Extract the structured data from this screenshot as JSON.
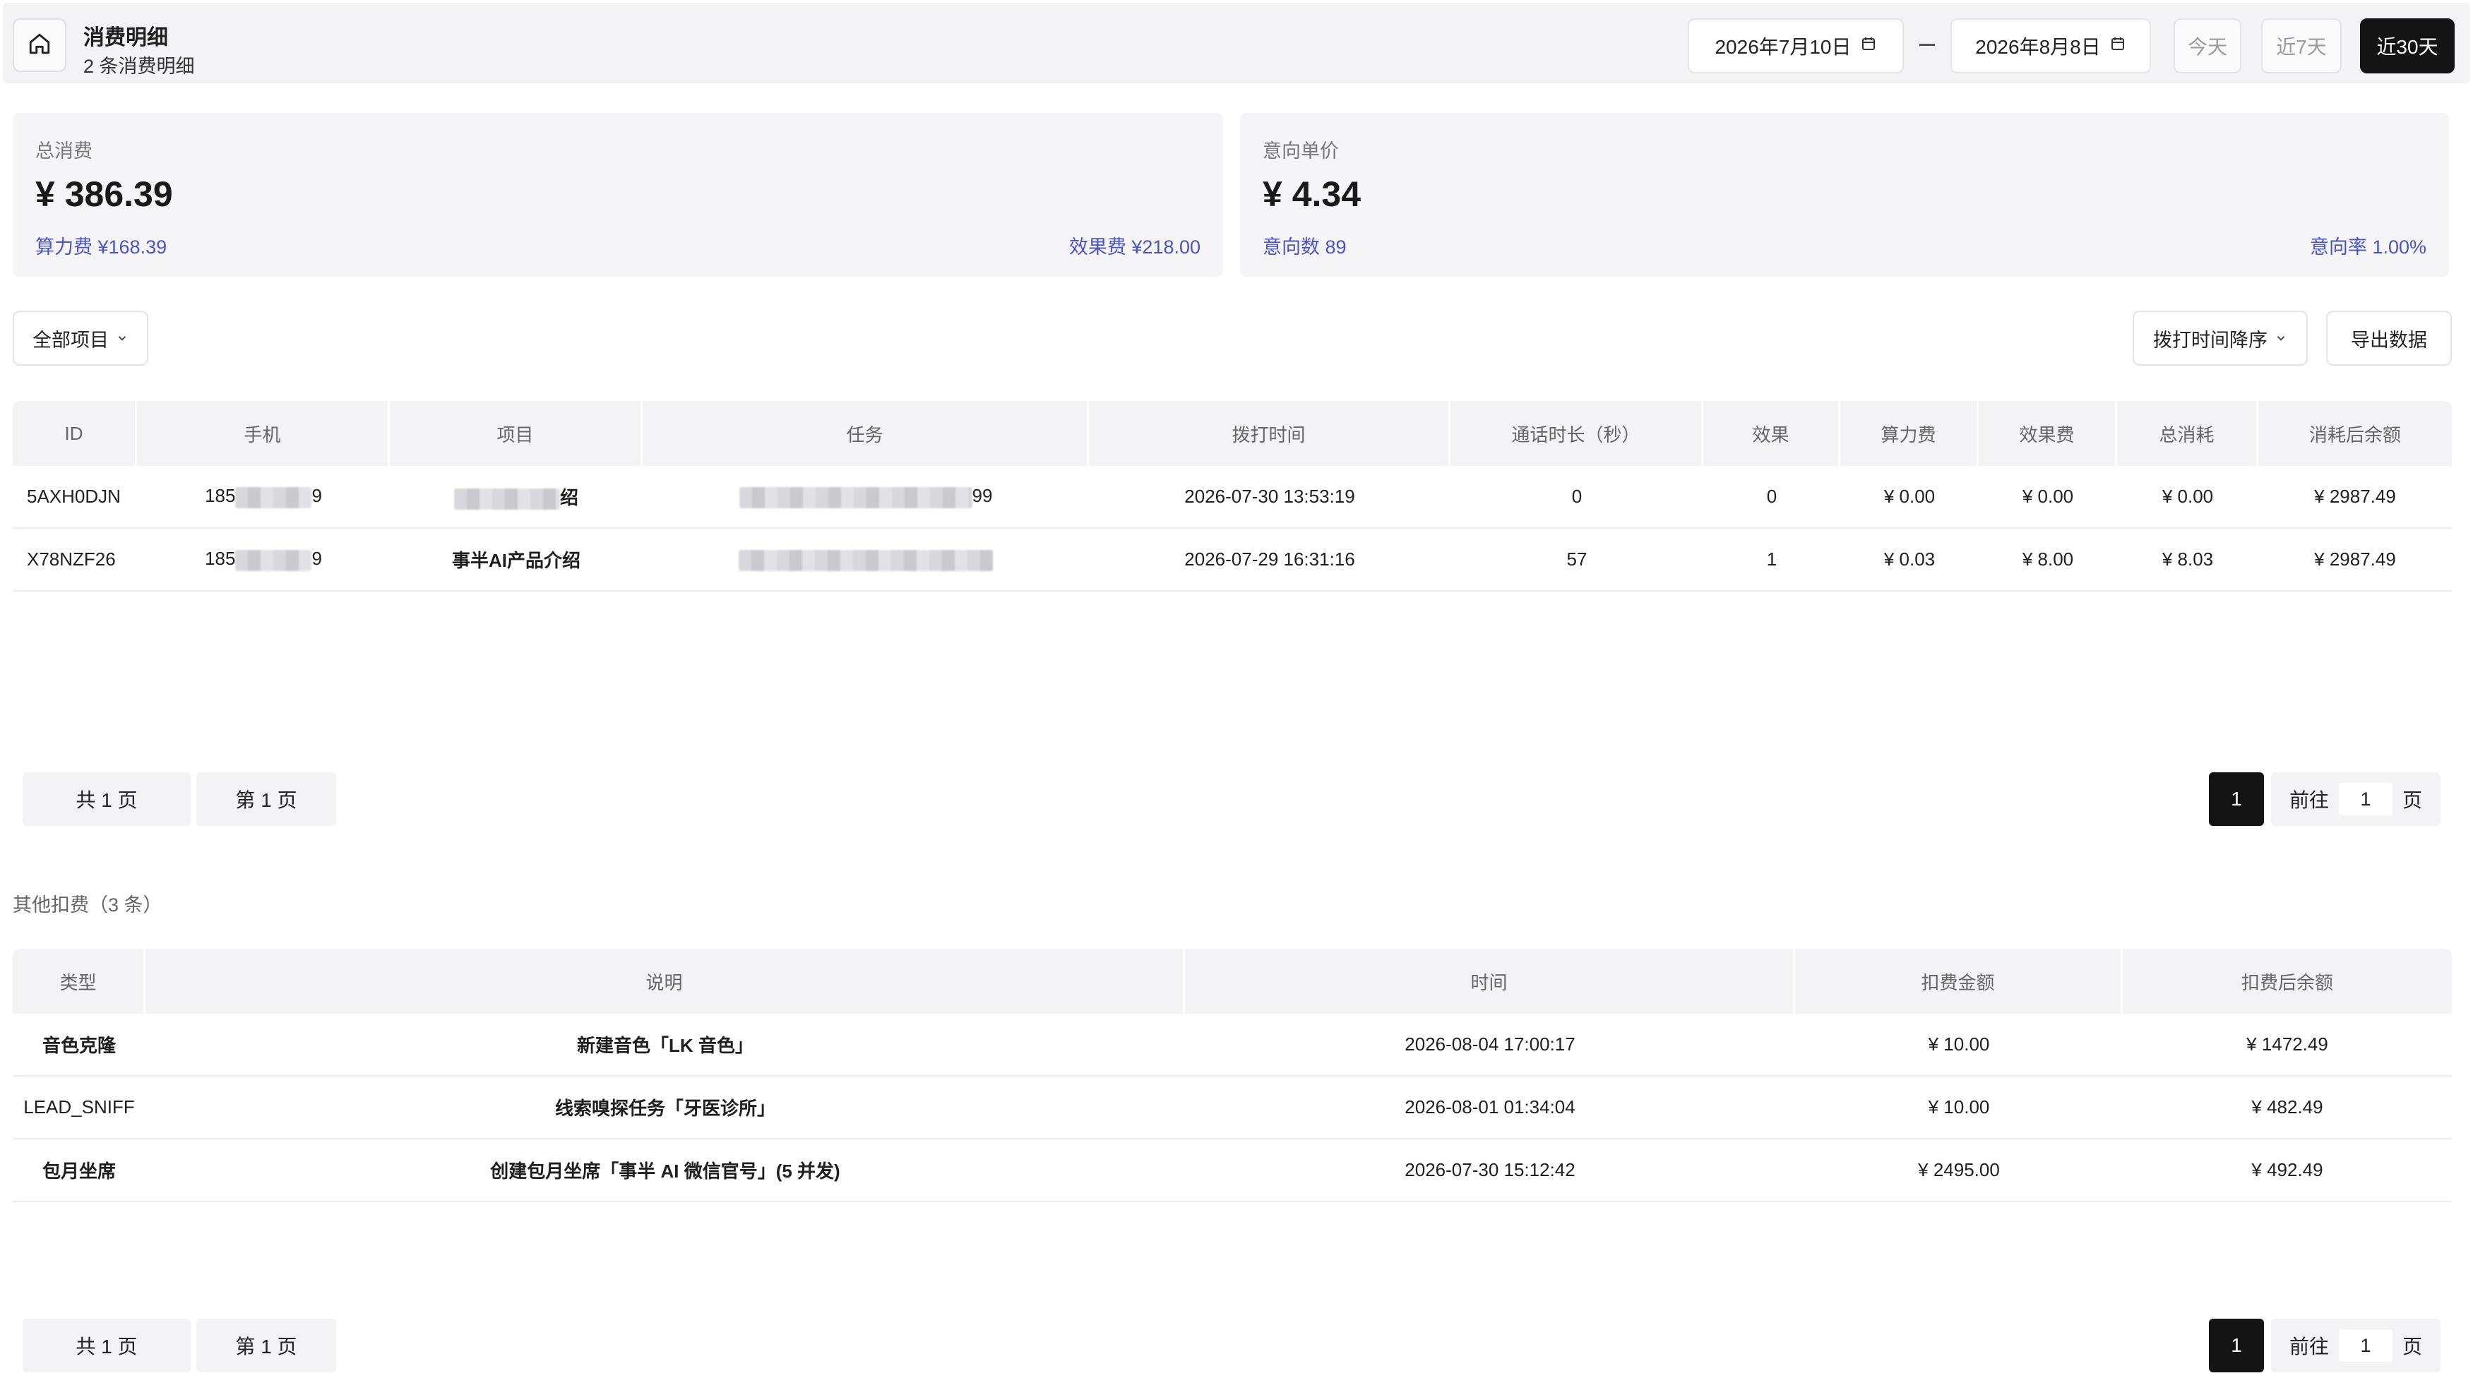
{
  "header": {
    "title": "消费明细",
    "subtitle": "2 条消费明细",
    "start_date": "2026年7月10日",
    "end_date": "2026年8月8日",
    "ranges": [
      "今天",
      "近7天",
      "近30天"
    ],
    "active_range": "近30天"
  },
  "summary": {
    "total": {
      "label": "总消费",
      "value": "¥ 386.39",
      "left_meta": "算力费 ¥168.39",
      "right_meta": "效果费 ¥218.00"
    },
    "intent": {
      "label": "意向单价",
      "value": "¥ 4.34",
      "left_meta": "意向数 89",
      "right_meta": "意向率 1.00%"
    }
  },
  "toolbar": {
    "project_filter": "全部项目",
    "sort_label": "拨打时间降序",
    "export_label": "导出数据"
  },
  "calls_table": {
    "headers": [
      "ID",
      "手机",
      "项目",
      "任务",
      "拨打时间",
      "通话时长（秒）",
      "效果",
      "算力费",
      "效果费",
      "总消耗",
      "消耗后余额"
    ],
    "rows": [
      {
        "id": "5AXH0DJN",
        "phone_prefix": "185",
        "phone_suffix": "9",
        "project_suffix": "绍",
        "task_suffix": "99",
        "call_time": "2026-07-30 13:53:19",
        "duration": "0",
        "effect": "0",
        "compute_fee": "¥ 0.00",
        "effect_fee": "¥ 0.00",
        "total": "¥ 0.00",
        "balance": "¥ 2987.49"
      },
      {
        "id": "X78NZF26",
        "phone_prefix": "185",
        "phone_suffix": "9",
        "project": "事半AI产品介绍",
        "call_time": "2026-07-29 16:31:16",
        "duration": "57",
        "effect": "1",
        "compute_fee": "¥ 0.03",
        "effect_fee": "¥ 8.00",
        "total": "¥ 8.03",
        "balance": "¥ 2987.49"
      }
    ]
  },
  "pagination1": {
    "total_pages": "共 1 页",
    "page": "第 1 页",
    "current": "1",
    "goto_label": "前往",
    "goto_value": "1",
    "goto_unit": "页"
  },
  "other_section": {
    "title": "其他扣费（3 条）"
  },
  "other_table": {
    "headers": [
      "类型",
      "说明",
      "时间",
      "扣费金额",
      "扣费后余额"
    ],
    "rows": [
      {
        "type": "音色克隆",
        "desc": "新建音色「LK 音色」",
        "time": "2026-08-04 17:00:17",
        "amount": "¥ 10.00",
        "balance": "¥ 1472.49"
      },
      {
        "type": "LEAD_SNIFF",
        "desc": "线索嗅探任务「牙医诊所」",
        "time": "2026-08-01 01:34:04",
        "amount": "¥ 10.00",
        "balance": "¥ 482.49"
      },
      {
        "type": "包月坐席",
        "desc": "创建包月坐席「事半 AI 微信官号」(5 并发)",
        "time": "2026-07-30 15:12:42",
        "amount": "¥ 2495.00",
        "balance": "¥ 492.49"
      }
    ]
  },
  "pagination2": {
    "total_pages": "共 1 页",
    "page": "第 1 页",
    "current": "1",
    "goto_label": "前往",
    "goto_value": "1",
    "goto_unit": "页"
  }
}
